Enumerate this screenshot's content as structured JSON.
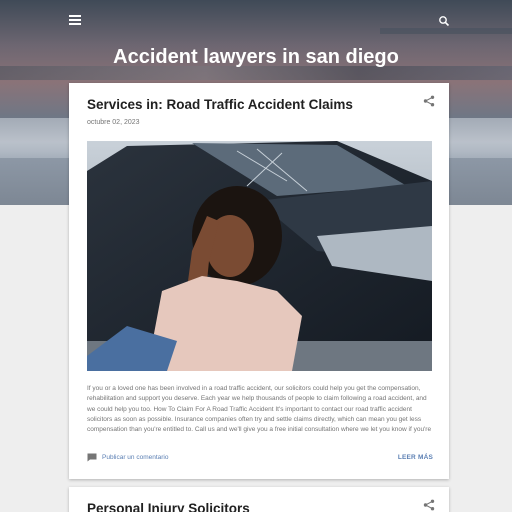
{
  "header": {
    "blog_title": "Accident lawyers in san diego",
    "menu_icon": "hamburger-menu-icon",
    "search_icon": "search-icon"
  },
  "posts": [
    {
      "title": "Services in: Road Traffic Accident Claims",
      "date": "octubre 02, 2023",
      "snippet": "If you or a loved one has been involved in a road traffic accident, our solicitors could help you get the compensation, rehabilitation and support you deserve. Each year we help thousands of people to claim following a road accident, and we could help you too. How To Claim For A Road Traffic Accident It's important to contact our road traffic accident solicitors as soon as possible. Insurance companies often try and settle claims directly, which can mean you get less compensation than you're entitled to. Call us and we'll give you a  free initial consultation  where we let you know if you're likely to…",
      "comment_label": "Publicar un comentario",
      "read_more": "LEER MÁS",
      "share_icon": "share-icon",
      "comment_icon": "comment-icon"
    },
    {
      "title": "Personal Injury Solicitors",
      "share_icon": "share-icon"
    }
  ],
  "colors": {
    "accent": "#5b7fb3",
    "title": "#212121",
    "muted": "#757575"
  }
}
